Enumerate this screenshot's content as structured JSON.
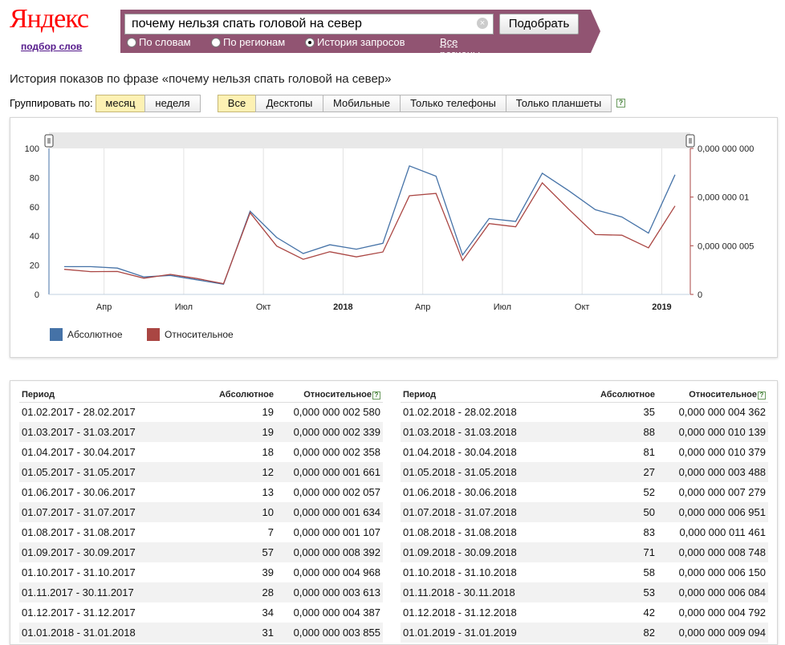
{
  "header": {
    "logo": "Яндекс",
    "podbor_link": "подбор слов",
    "search_value": "почему нельзя спать головой на север",
    "pick_button": "Подобрать",
    "radios": [
      {
        "label": "По словам",
        "selected": false
      },
      {
        "label": "По регионам",
        "selected": false
      },
      {
        "label": "История запросов",
        "selected": true
      }
    ],
    "all_regions": "Все регионы",
    "bar_color": "#915472"
  },
  "page_title": "История показов по фразе «почему нельзя спать головой на север»",
  "grouping": {
    "label": "Группировать по:",
    "month": "месяц",
    "week": "неделя"
  },
  "devices": {
    "all": "Все",
    "desktop": "Десктопы",
    "mobile": "Мобильные",
    "phones": "Только телефоны",
    "tablets": "Только планшеты"
  },
  "help_glyph": "?",
  "chart_data": {
    "type": "line",
    "x": [
      "2017-02",
      "2017-03",
      "2017-04",
      "2017-05",
      "2017-06",
      "2017-07",
      "2017-08",
      "2017-09",
      "2017-10",
      "2017-11",
      "2017-12",
      "2018-01",
      "2018-02",
      "2018-03",
      "2018-04",
      "2018-05",
      "2018-06",
      "2018-07",
      "2018-08",
      "2018-09",
      "2018-10",
      "2018-11",
      "2018-12",
      "2019-01"
    ],
    "series": [
      {
        "name": "Абсолютное",
        "axis": "left",
        "color": "#4572a7",
        "values": [
          19,
          19,
          18,
          12,
          13,
          10,
          7,
          57,
          39,
          28,
          34,
          31,
          35,
          88,
          81,
          27,
          52,
          50,
          83,
          71,
          58,
          53,
          42,
          82
        ]
      },
      {
        "name": "Относительное",
        "axis": "right",
        "color": "#aa4643",
        "values": [
          2.58e-09,
          2.339e-09,
          2.358e-09,
          1.661e-09,
          2.057e-09,
          1.634e-09,
          1.107e-09,
          8.392e-09,
          4.968e-09,
          3.613e-09,
          4.387e-09,
          3.855e-09,
          4.362e-09,
          1.0139e-08,
          1.0379e-08,
          3.488e-09,
          7.279e-09,
          6.951e-09,
          1.1461e-08,
          8.748e-09,
          6.15e-09,
          6.084e-09,
          4.792e-09,
          9.094e-09
        ]
      }
    ],
    "left_axis": {
      "ticks": [
        "0",
        "20",
        "40",
        "60",
        "80",
        "100"
      ],
      "ylim": [
        0,
        100
      ]
    },
    "right_axis": {
      "ticks": [
        "0",
        "0,000 000 005",
        "0,000 000 01",
        "0,000 000 000"
      ],
      "ylim": [
        0,
        1.5e-08
      ]
    },
    "x_labels": [
      "Апр",
      "Июл",
      "Окт",
      "2018",
      "Апр",
      "Июл",
      "Окт",
      "2019"
    ],
    "x_label_months": [
      "2017-04",
      "2017-07",
      "2017-10",
      "2018-01",
      "2018-04",
      "2018-07",
      "2018-10",
      "2019-01"
    ],
    "bold_labels": [
      "2018",
      "2019"
    ],
    "legend_placement": "bottom-left",
    "grid": true
  },
  "table": {
    "headers": {
      "period": "Период",
      "absolute": "Абсолютное",
      "relative": "Относительное"
    },
    "left": [
      [
        "01.02.2017 - 28.02.2017",
        "19",
        "0,000 000 002 580"
      ],
      [
        "01.03.2017 - 31.03.2017",
        "19",
        "0,000 000 002 339"
      ],
      [
        "01.04.2017 - 30.04.2017",
        "18",
        "0,000 000 002 358"
      ],
      [
        "01.05.2017 - 31.05.2017",
        "12",
        "0,000 000 001 661"
      ],
      [
        "01.06.2017 - 30.06.2017",
        "13",
        "0,000 000 002 057"
      ],
      [
        "01.07.2017 - 31.07.2017",
        "10",
        "0,000 000 001 634"
      ],
      [
        "01.08.2017 - 31.08.2017",
        "7",
        "0,000 000 001 107"
      ],
      [
        "01.09.2017 - 30.09.2017",
        "57",
        "0,000 000 008 392"
      ],
      [
        "01.10.2017 - 31.10.2017",
        "39",
        "0,000 000 004 968"
      ],
      [
        "01.11.2017 - 30.11.2017",
        "28",
        "0,000 000 003 613"
      ],
      [
        "01.12.2017 - 31.12.2017",
        "34",
        "0,000 000 004 387"
      ],
      [
        "01.01.2018 - 31.01.2018",
        "31",
        "0,000 000 003 855"
      ]
    ],
    "right": [
      [
        "01.02.2018 - 28.02.2018",
        "35",
        "0,000 000 004 362"
      ],
      [
        "01.03.2018 - 31.03.2018",
        "88",
        "0,000 000 010 139"
      ],
      [
        "01.04.2018 - 30.04.2018",
        "81",
        "0,000 000 010 379"
      ],
      [
        "01.05.2018 - 31.05.2018",
        "27",
        "0,000 000 003 488"
      ],
      [
        "01.06.2018 - 30.06.2018",
        "52",
        "0,000 000 007 279"
      ],
      [
        "01.07.2018 - 31.07.2018",
        "50",
        "0,000 000 006 951"
      ],
      [
        "01.08.2018 - 31.08.2018",
        "83",
        "0,000 000 011 461"
      ],
      [
        "01.09.2018 - 30.09.2018",
        "71",
        "0,000 000 008 748"
      ],
      [
        "01.10.2018 - 31.10.2018",
        "58",
        "0,000 000 006 150"
      ],
      [
        "01.11.2018 - 30.11.2018",
        "53",
        "0,000 000 006 084"
      ],
      [
        "01.12.2018 - 31.12.2018",
        "42",
        "0,000 000 004 792"
      ],
      [
        "01.01.2019 - 31.01.2019",
        "82",
        "0,000 000 009 094"
      ]
    ]
  }
}
